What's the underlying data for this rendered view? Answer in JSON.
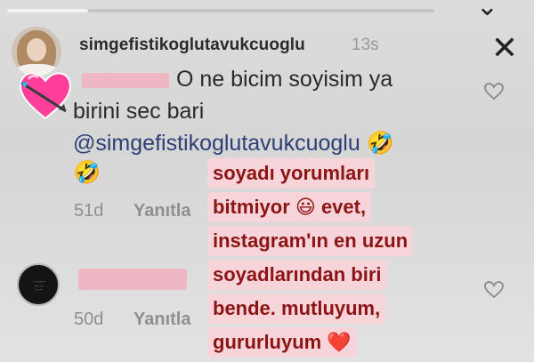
{
  "story": {
    "username": "simgefistikoglutavukcuoglu",
    "time": "13s",
    "close_icon": "close-icon",
    "progress": 0.19
  },
  "comments": [
    {
      "lines": [
        "O ne bicim  soyisim ya",
        "birini sec bari",
        "@simgefistikoglutavukcuoglu 🤣",
        "🤣"
      ],
      "age": "51d",
      "reply_label": "Yanıtla"
    },
    {
      "age": "50d",
      "reply_label": "Yanıtla"
    }
  ],
  "reply_card": {
    "lines": [
      "soyadı yorumları",
      "bitmiyor 😃 evet,",
      "instagram'ın en uzun",
      "soyadlarından biri",
      "bende. mutluyum,",
      "gururluyum ❤️"
    ]
  },
  "colors": {
    "blur": "#f1b1c0",
    "highlight_bg": "#f7d4d9",
    "highlight_text": "#8b1414",
    "mention": "#2d3f74"
  }
}
